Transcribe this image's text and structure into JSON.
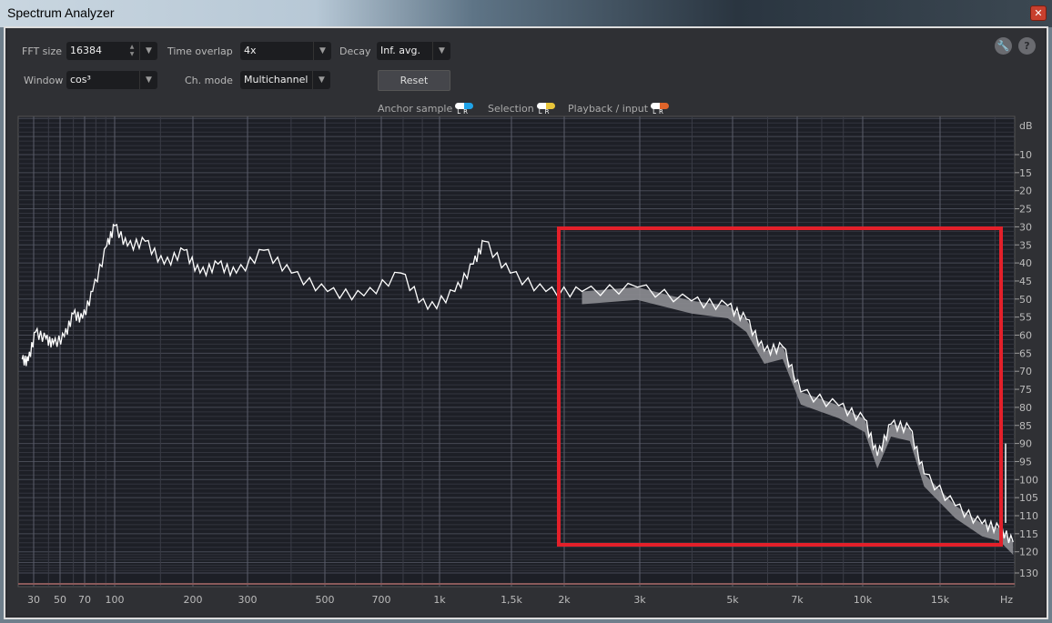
{
  "window": {
    "title": "Spectrum Analyzer",
    "close_icon": "close-icon"
  },
  "controls": {
    "fft_size": {
      "label": "FFT size",
      "value": "16384"
    },
    "time_overlap": {
      "label": "Time overlap",
      "value": "4x"
    },
    "decay": {
      "label": "Decay",
      "value": "Inf. avg."
    },
    "window": {
      "label": "Window",
      "value": "cos³"
    },
    "ch_mode": {
      "label": "Ch. mode",
      "value": "Multichannel"
    },
    "reset_label": "Reset",
    "settings_icon": "wrench-icon",
    "help_icon": "question-icon",
    "help_glyph": "?"
  },
  "legend": [
    {
      "label": "Anchor sample",
      "l": "L",
      "r": "R",
      "color_l": "#ffffff",
      "color_r": "#1fa3e8"
    },
    {
      "label": "Selection",
      "l": "L",
      "r": "R",
      "color_l": "#ffffff",
      "color_r": "#e8c53a"
    },
    {
      "label": "Playback / input",
      "l": "L",
      "r": "R",
      "color_l": "#ffffff",
      "color_r": "#e0642a"
    }
  ],
  "chart_data": {
    "type": "line",
    "xscale": "log",
    "xlabel": "Hz",
    "ylabel": "dB",
    "x_ticks": [
      "30",
      "50",
      "70",
      "100",
      "200",
      "300",
      "500",
      "700",
      "1k",
      "1,5k",
      "2k",
      "3k",
      "5k",
      "7k",
      "10k",
      "15k"
    ],
    "y_ticks": [
      "10",
      "15",
      "20",
      "25",
      "30",
      "35",
      "40",
      "45",
      "50",
      "55",
      "60",
      "65",
      "70",
      "75",
      "80",
      "85",
      "90",
      "95",
      "100",
      "105",
      "110",
      "115",
      "120",
      "130"
    ],
    "grid": true,
    "series": [
      {
        "color": "#ffffff",
        "points": [
          [
            24,
            66.7
          ],
          [
            27,
            67.2
          ],
          [
            31,
            59.2
          ],
          [
            38,
            60.9
          ],
          [
            44,
            62.4
          ],
          [
            53,
            60.4
          ],
          [
            60,
            54.1
          ],
          [
            68,
            55.4
          ],
          [
            77,
            47.9
          ],
          [
            91,
            35.3
          ],
          [
            100,
            29.7
          ],
          [
            112,
            35.3
          ],
          [
            131,
            34
          ],
          [
            155,
            40.3
          ],
          [
            185,
            36.5
          ],
          [
            211,
            42.8
          ],
          [
            241,
            40.3
          ],
          [
            276,
            42.8
          ],
          [
            334,
            36.5
          ],
          [
            401,
            42.8
          ],
          [
            508,
            47.9
          ],
          [
            631,
            49.1
          ],
          [
            789,
            42.8
          ],
          [
            930,
            52.8
          ],
          [
            1090,
            47.9
          ],
          [
            1210,
            40.3
          ],
          [
            1285,
            34
          ],
          [
            1490,
            42.8
          ],
          [
            1810,
            47.9
          ],
          [
            2200,
            47.9
          ],
          [
            2960,
            46.7
          ],
          [
            3990,
            50.5
          ],
          [
            4870,
            51.8
          ],
          [
            5370,
            55.6
          ],
          [
            5900,
            64.4
          ],
          [
            6490,
            63.1
          ],
          [
            7140,
            75.7
          ],
          [
            8780,
            79.5
          ],
          [
            10100,
            83.3
          ],
          [
            10800,
            93.4
          ],
          [
            11600,
            84.6
          ],
          [
            12800,
            85.8
          ],
          [
            13800,
            98.4
          ],
          [
            16250,
            107.2
          ],
          [
            18700,
            112.2
          ],
          [
            20500,
            113.5
          ],
          [
            22000,
            117.3
          ]
        ]
      }
    ],
    "highlight_color": "#e3202a"
  }
}
